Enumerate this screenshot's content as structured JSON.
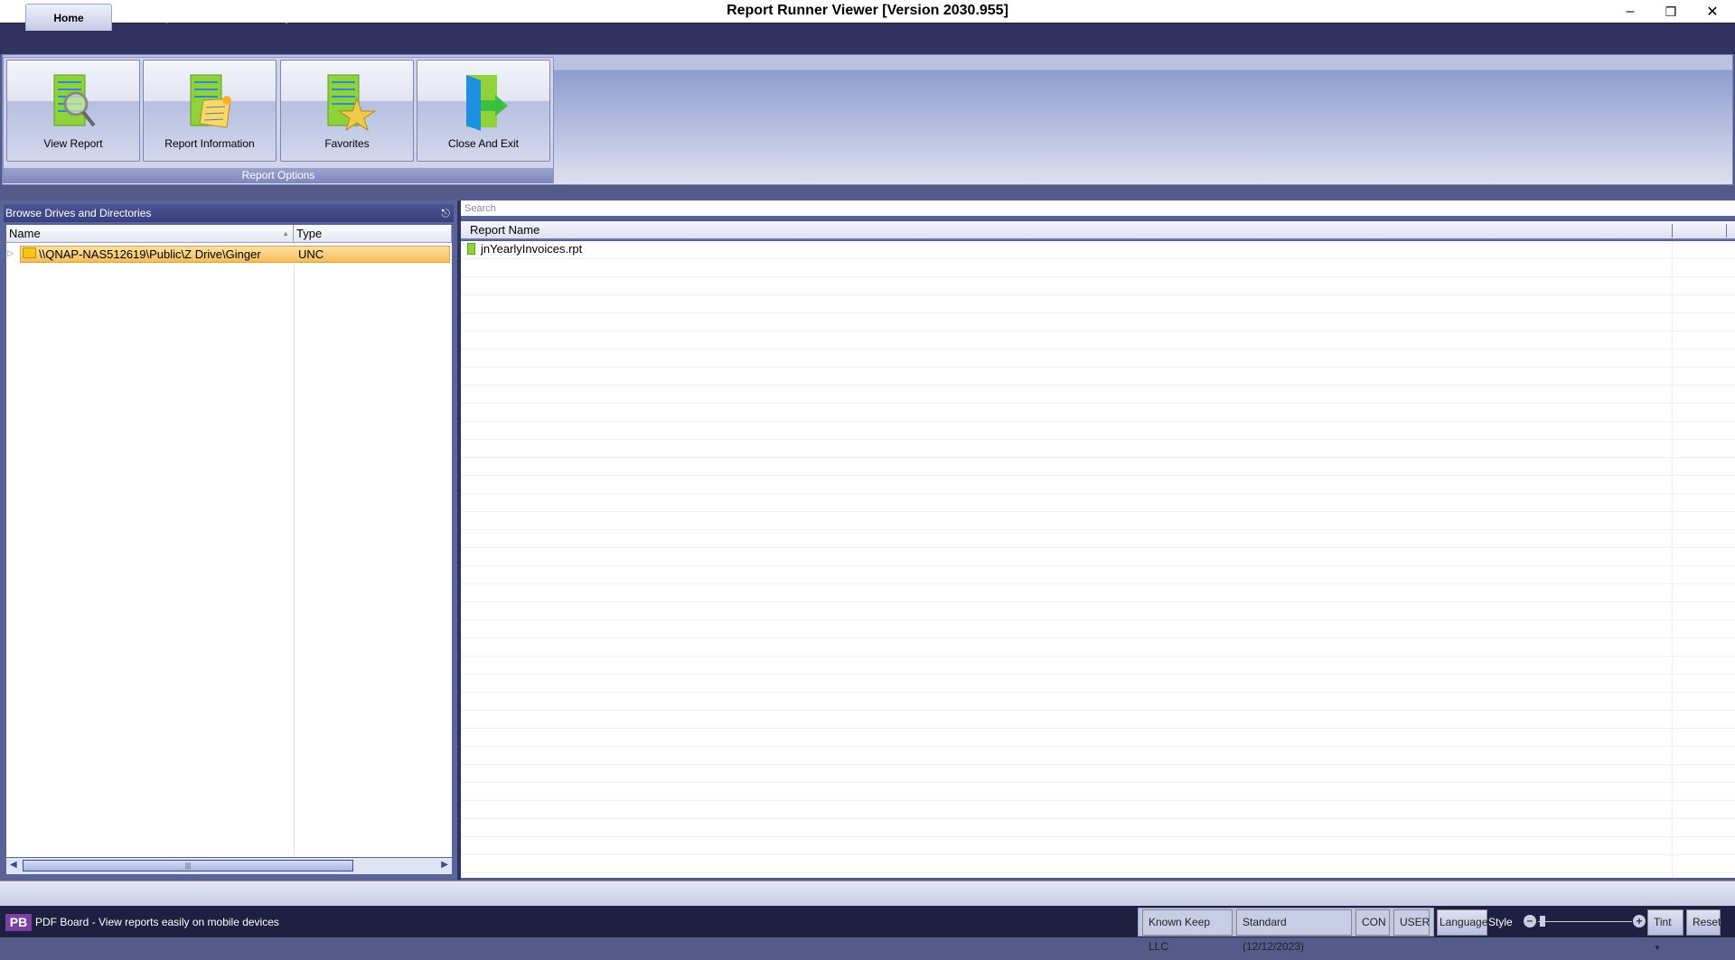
{
  "window": {
    "title": "Report Runner Viewer [Version 2030.955]"
  },
  "tabs": [
    {
      "label": "Home",
      "active": true
    },
    {
      "label": "Help"
    },
    {
      "label": "About/Licensing"
    }
  ],
  "ribbon": {
    "group_label": "Report Options",
    "buttons": [
      {
        "label": "View Report",
        "icon": "document-magnifier-icon"
      },
      {
        "label": "Report Information",
        "icon": "document-note-icon"
      },
      {
        "label": "Favorites",
        "icon": "document-star-icon"
      },
      {
        "label": "Close And Exit",
        "icon": "exit-door-icon"
      }
    ]
  },
  "left_panel": {
    "title": "Browse Drives and Directories",
    "columns": [
      "Name",
      "Type"
    ],
    "rows": [
      {
        "name": "\\\\QNAP-NAS512619\\Public\\Z Drive\\Ginger",
        "type": "UNC",
        "selected": true
      }
    ]
  },
  "right_panel": {
    "search_placeholder": "Search",
    "column": "Report Name",
    "rows": [
      {
        "name": "jnYearlyInvoices.rpt"
      }
    ]
  },
  "status": {
    "promo": "PDF Board - View reports easily on mobile devices",
    "company": "Known Keep LLC",
    "license": "Standard (12/12/2023)",
    "con": "CON",
    "user": "USER",
    "language": "Language",
    "style": "Style",
    "tint": "Tint",
    "reset": "Reset"
  },
  "colors": {
    "accent": "#31335e",
    "selection": "#f7bd58"
  }
}
